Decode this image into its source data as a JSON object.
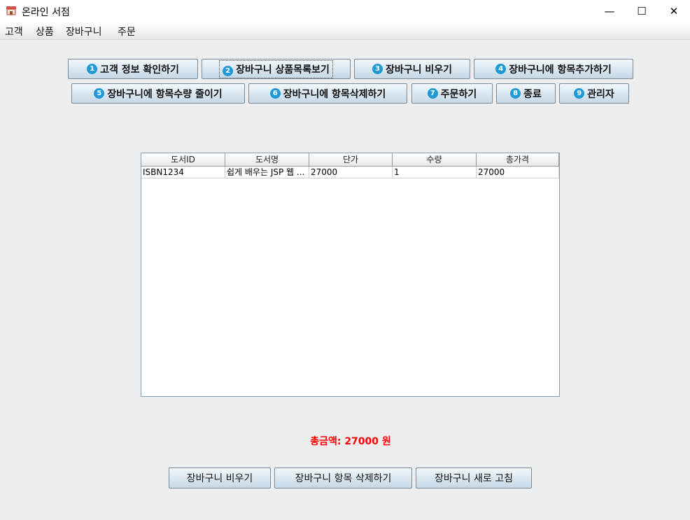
{
  "window": {
    "title": "온라인 서점",
    "minimize": "—",
    "maximize": "☐",
    "close": "✕"
  },
  "menu": [
    "고객",
    "상품",
    "장바구니",
    "주문"
  ],
  "top_buttons": [
    {
      "num": "1",
      "label": "고객 정보 확인하기"
    },
    {
      "num": "2",
      "label": "장바구니 상품목록보기"
    },
    {
      "num": "3",
      "label": "장바구니 비우기"
    },
    {
      "num": "4",
      "label": "장바구니에 항목추가하기"
    },
    {
      "num": "5",
      "label": "장바구니에 항목수량 줄이기"
    },
    {
      "num": "6",
      "label": "장바구니에 항목삭제하기"
    },
    {
      "num": "7",
      "label": "주문하기"
    },
    {
      "num": "8",
      "label": "종료"
    },
    {
      "num": "9",
      "label": "관리자"
    }
  ],
  "table": {
    "headers": [
      "도서ID",
      "도서명",
      "단가",
      "수량",
      "총가격"
    ],
    "rows": [
      [
        "ISBN1234",
        "쉽게 배우는 JSP 웹 ...",
        "27000",
        "1",
        "27000"
      ]
    ]
  },
  "total": "총금액: 27000 원",
  "bottom_buttons": [
    "장바구니 비우기",
    "장바구니 항목 삭제하기",
    "장바구니 새로 고침"
  ]
}
